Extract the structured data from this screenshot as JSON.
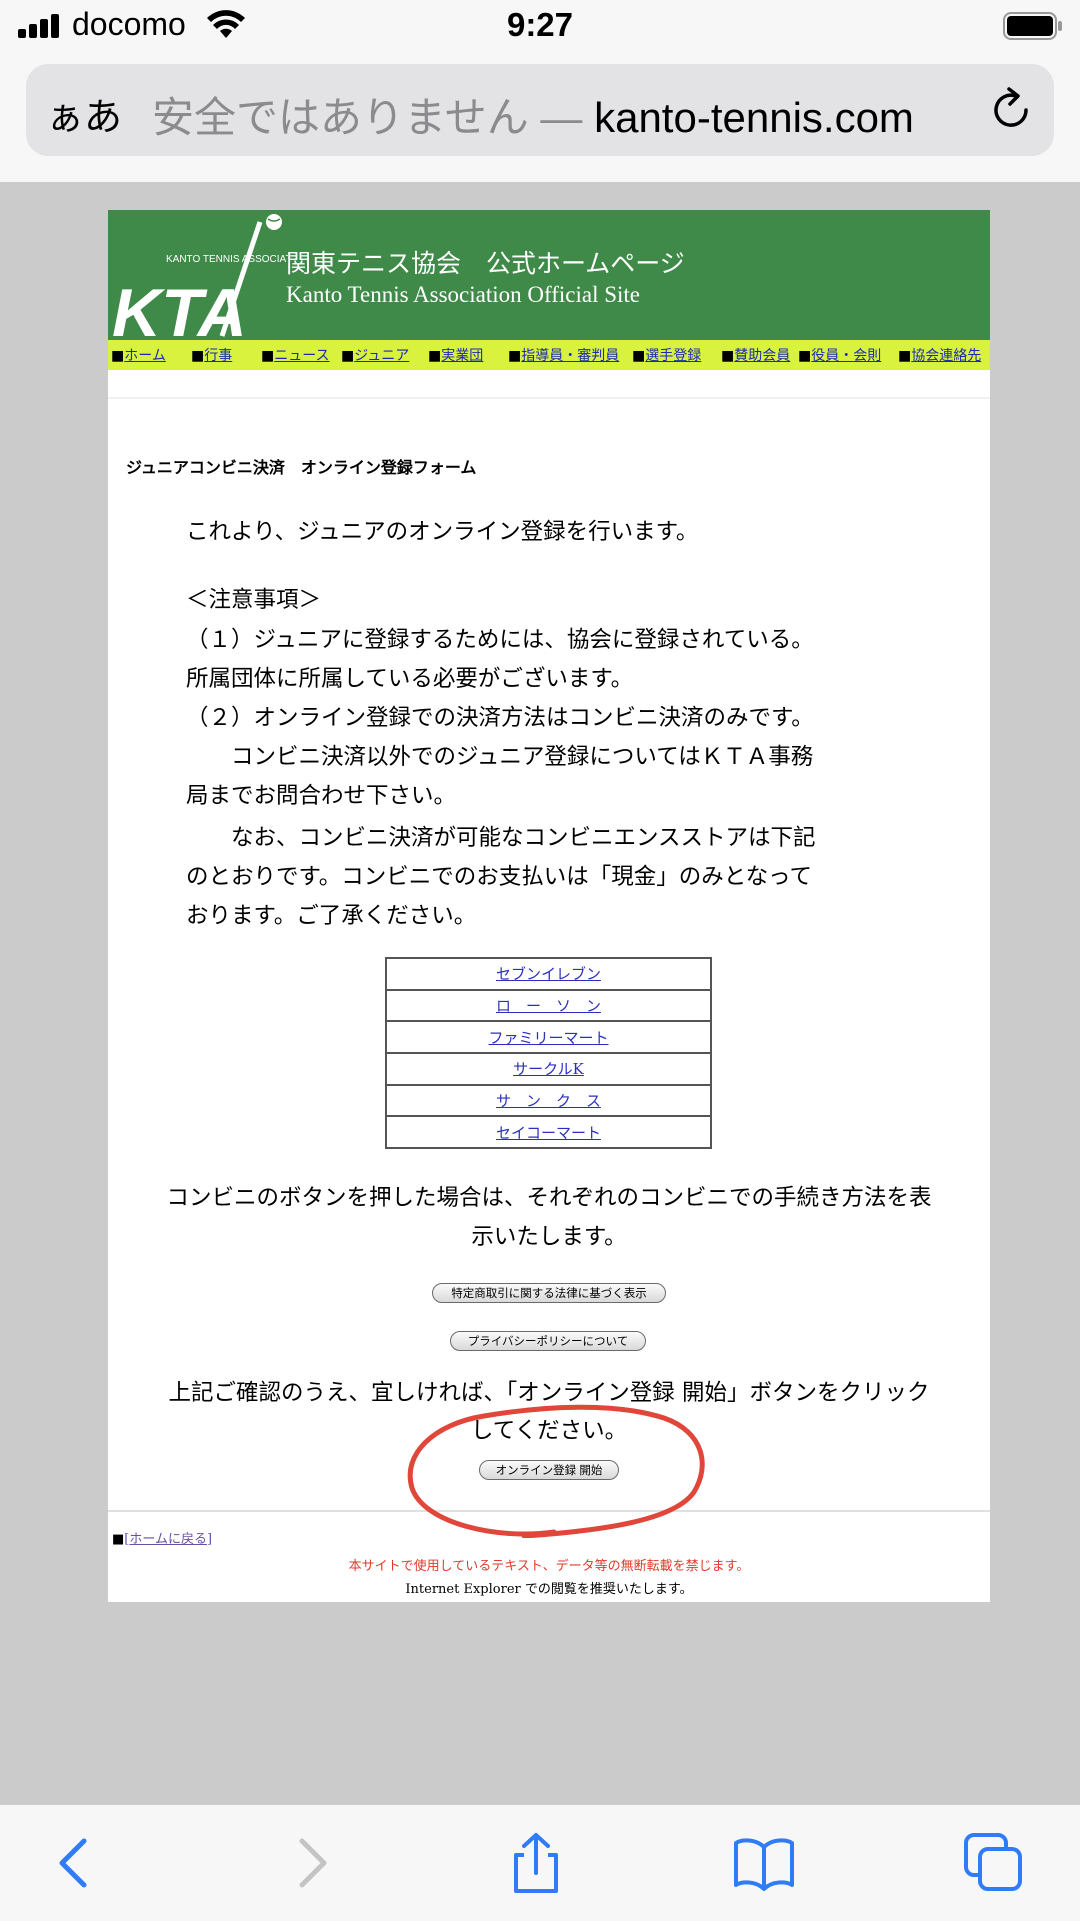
{
  "status_bar": {
    "carrier": "docomo",
    "time": "9:27"
  },
  "browser": {
    "aa_label": "ぁあ",
    "insecure_label": "安全ではありません —",
    "domain": "kanto-tennis.com"
  },
  "site": {
    "title_ja": "関東テニス協会　公式ホームページ",
    "title_en": "Kanto Tennis Association Official Site",
    "logo_small_text": "KANTO TENNIS ASSOCIATION",
    "logo_letters": "KTA",
    "nav": [
      {
        "label": "ホーム"
      },
      {
        "label": "行事"
      },
      {
        "label": "ニュース"
      },
      {
        "label": "ジュニア"
      },
      {
        "label": "実業団"
      },
      {
        "label": "指導員・審判員"
      },
      {
        "label": "選手登録"
      },
      {
        "label": "賛助会員"
      },
      {
        "label": "役員・会則"
      },
      {
        "label": "協会連絡先"
      }
    ]
  },
  "content": {
    "form_title": "ジュニアコンビニ決済　オンライン登録フォーム",
    "intro": "これより、ジュニアのオンライン登録を行います。",
    "notes_heading": "＜注意事項＞",
    "notes": [
      "（１）ジュニアに登録するためには、協会に登録されている。",
      "所属団体に所属している必要がございます。",
      "（２）オンライン登録での決済方法はコンビニ決済のみです。",
      "　　コンビニ決済以外でのジュニア登録についてはＫＴＡ事務",
      "局までお問合わせ下さい。",
      "　　なお、コンビニ決済が可能なコンビニエンスストアは下記",
      "のとおりです。コンビニでのお支払いは「現金」のみとなって",
      "おります。ご了承ください。"
    ],
    "stores": [
      "セブンイレブン",
      "ロ　ー　ソ　ン",
      "ファミリーマート",
      "サークルK",
      "サ　ン　ク　ス",
      "セイコーマート"
    ],
    "store_note_1": "コンビニのボタンを押した場合は、それぞれのコンビニでの手続き方法を表",
    "store_note_2": "示いたします。",
    "btn_tokutei": "特定商取引に関する法律に基づく表示",
    "btn_privacy": "プライバシーポリシーについて",
    "confirm_1": "上記ご確認のうえ、宜しければ、「オンライン登録 開始」ボタンをクリック",
    "confirm_2": "してください。",
    "btn_start": "オンライン登録 開始",
    "back_home": "ホームに戻る",
    "copyright": "本サイトで使用しているテキスト、データ等の無断転載を禁じます。",
    "ie_note": "Internet Explorer での閲覧を推奨いたします。"
  },
  "colors": {
    "header_green": "#3f8a49",
    "nav_yellow": "#d8f23e",
    "annotation_red": "#e0473a",
    "ios_blue": "#2f7cf6"
  }
}
